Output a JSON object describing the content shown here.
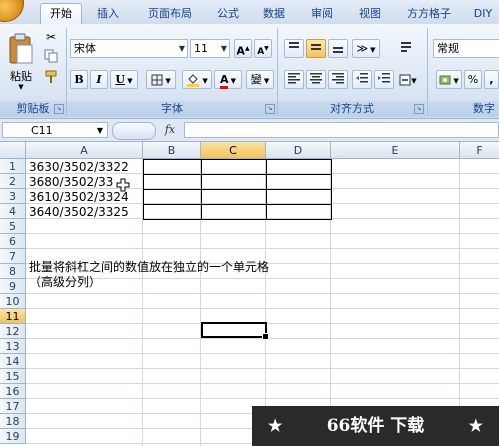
{
  "tabs": [
    "开始",
    "插入",
    "页面布局",
    "公式",
    "数据",
    "审阅",
    "视图",
    "方方格子",
    "DIY"
  ],
  "clipboard": {
    "paste_label": "粘贴",
    "group_label": "剪贴板"
  },
  "font": {
    "name": "宋体",
    "size": "11",
    "grow": "A",
    "shrink": "A",
    "bold": "B",
    "italic": "I",
    "underline": "U",
    "font_color_letter": "A",
    "phonetic": "變",
    "group_label": "字体",
    "accent_fill": "#ffd700",
    "accent_text": "#ff0000"
  },
  "alignment": {
    "group_label": "对齐方式"
  },
  "number": {
    "format": "常规",
    "percent": "%",
    "comma": ",",
    "group_label": "数字"
  },
  "formula_bar": {
    "name_box": "C11",
    "fx": "fx",
    "value": ""
  },
  "columns": [
    "A",
    "B",
    "C",
    "D",
    "E",
    "F"
  ],
  "rows": [
    "1",
    "2",
    "3",
    "4",
    "5",
    "6",
    "7",
    "8",
    "9",
    "10",
    "11",
    "12",
    "13",
    "14",
    "15",
    "16",
    "17",
    "18",
    "19"
  ],
  "selected_column": "C",
  "selected_row": "11",
  "cells": {
    "A1": "3630/3502/3322",
    "A2": "3680/3502/33",
    "A3": "3610/3502/3324",
    "A4": "3640/3502/3325",
    "A7": "批量将斜杠之间的数值放在独立的一个单元格",
    "A8": "（高级分列）"
  },
  "watermark": {
    "star": "★",
    "text": "66软件 下载"
  }
}
